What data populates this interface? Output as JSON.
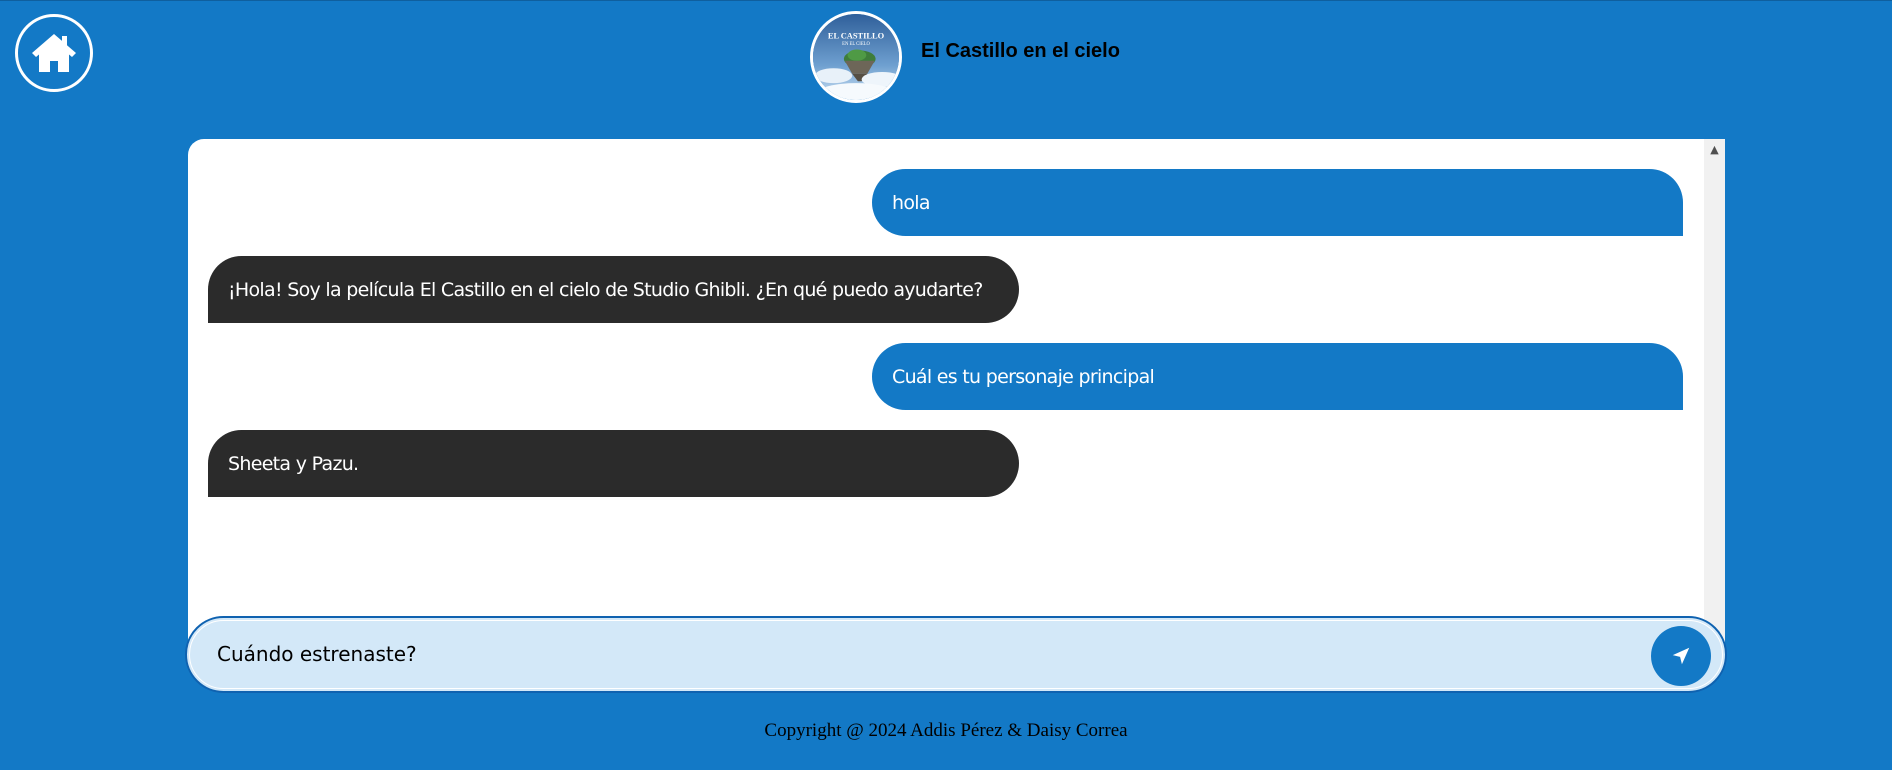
{
  "header": {
    "home_icon": "home-icon",
    "title": "El Castillo en el cielo",
    "avatar_poster_line1": "EL CASTILLO",
    "avatar_poster_line2": "EN EL CIELO"
  },
  "chat": {
    "messages": [
      {
        "role": "user",
        "text": "hola"
      },
      {
        "role": "bot",
        "text": "¡Hola! Soy la película El Castillo en el cielo de Studio Ghibli. ¿En qué puedo ayudarte?"
      },
      {
        "role": "user",
        "text": "Cuál es tu personaje principal"
      },
      {
        "role": "bot",
        "text": "Sheeta y Pazu."
      }
    ]
  },
  "input": {
    "value": "Cuándo estrenaste?",
    "send_icon": "send-icon"
  },
  "footer": {
    "text": "Copyright @ 2024 Addis Pérez & Daisy Correa"
  },
  "colors": {
    "background": "#1379c6",
    "user_bubble": "#1379c6",
    "bot_bubble": "#2b2b2b",
    "input_bg": "#d3e8f8"
  }
}
